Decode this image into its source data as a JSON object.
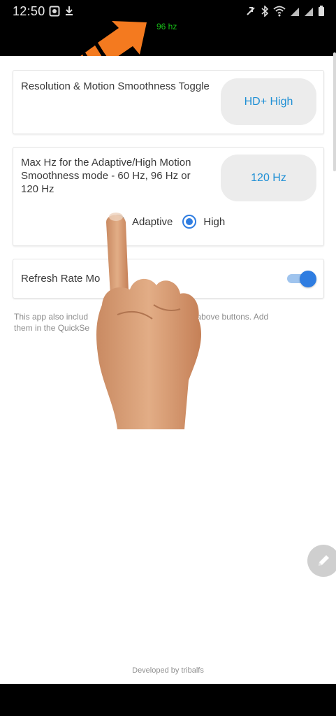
{
  "statusbar": {
    "time": "12:50",
    "refresh_readout": "96 hz",
    "left_icons": [
      "gallery-icon",
      "download-icon"
    ],
    "right_icons": [
      "mute-icon",
      "bluetooth-icon",
      "wifi-icon",
      "signal-icon",
      "signal-icon-2",
      "battery-icon"
    ]
  },
  "cards": {
    "resolution": {
      "label": "Resolution & Motion Smoothness Toggle",
      "button_label": "HD+ High"
    },
    "max_hz": {
      "label": "Max Hz for the Adaptive/High Motion Smoothness mode - 60 Hz, 96 Hz or 120 Hz",
      "button_label": "120 Hz",
      "options": [
        {
          "label": "Adaptive",
          "checked": false
        },
        {
          "label": "High",
          "checked": true
        }
      ]
    },
    "refresh_rate": {
      "label": "Refresh Rate Mo",
      "toggle_on": true
    }
  },
  "note": {
    "part1": "This app also includ",
    "part2": "for the above buttons. Add",
    "part3": "them in the QuickSe"
  },
  "fab_icon": "pencil-icon",
  "footer": "Developed by tribalfs",
  "colors": {
    "accent": "#2f7de1",
    "pill_text": "#1e8fd5",
    "readout": "#18c018",
    "overlay_arrow": "#f47a1f"
  }
}
